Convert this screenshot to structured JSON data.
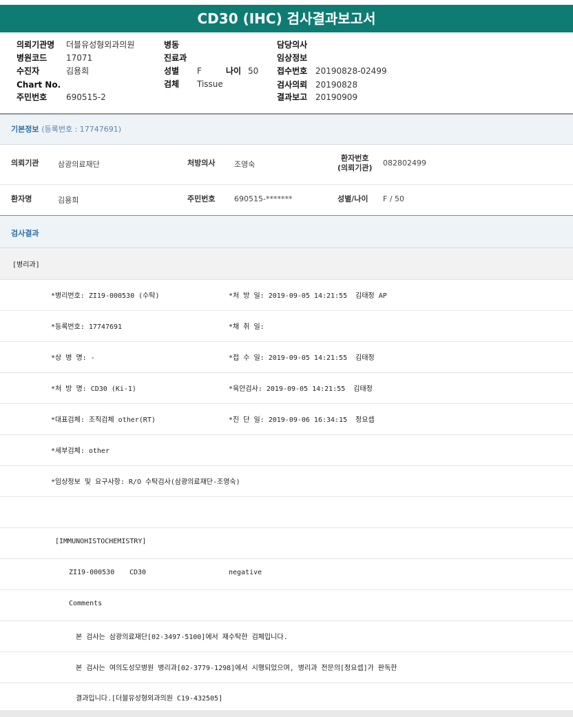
{
  "title": "CD30 (IHC) 검사결과보고서",
  "header": {
    "col1": [
      {
        "k": "의뢰기관명",
        "v": "더블유성형외과의원"
      },
      {
        "k": "병원코드",
        "v": "17071"
      },
      {
        "k": "수진자",
        "v": "김용희"
      },
      {
        "k": "Chart No.",
        "v": ""
      },
      {
        "k": "주민번호",
        "v": "690515-2"
      }
    ],
    "col2": [
      {
        "k": "병동",
        "v": ""
      },
      {
        "k": "진료과",
        "v": ""
      },
      {
        "k": "성별",
        "v": "F"
      },
      {
        "k": "검체",
        "v": "Tissue"
      }
    ],
    "age": {
      "k": "나이",
      "v": "50"
    },
    "col3": [
      {
        "k": "담당의사",
        "v": ""
      },
      {
        "k": "임상정보",
        "v": ""
      },
      {
        "k": "접수번호",
        "v": "20190828-02499"
      },
      {
        "k": "검사의뢰",
        "v": "20190828"
      },
      {
        "k": "결과보고",
        "v": "20190909"
      }
    ]
  },
  "basic": {
    "title": "기본정보",
    "subtitle": "(등록번호 : 17747691)",
    "row1": {
      "k1": "의뢰기관",
      "v1": "삼광의료재단",
      "k2": "처방의사",
      "v2": "조영숙",
      "k3a": "환자번호",
      "k3b": "(의뢰기관)",
      "v3": "082802499"
    },
    "row2": {
      "k1": "환자명",
      "v1": "김용희",
      "k2": "주민번호",
      "v2": "690515-*******",
      "k3": "성별/나이",
      "v3": "F / 50"
    }
  },
  "results": {
    "title": "검사결과",
    "dept": "[병리과]",
    "lines": [
      {
        "a": "*병리번호: ZI19-000530 (수탁)",
        "b": "*처 방 일: 2019-09-05 14:21:55  김태정 AP"
      },
      {
        "a": "*등록번호: 17747691",
        "b": "*채 취 일:"
      },
      {
        "a": "*상 병 명: -",
        "b": "*접 수 일: 2019-09-05 14:21:55  김태정"
      },
      {
        "a": "*처 방 명: CD30 (Ki-1)",
        "b": "*육안검사: 2019-09-05 14:21:55  김태정"
      },
      {
        "a": "*대표검체: 조직검체 other(RT)",
        "b": "*진 단 일: 2019-09-06 16:34:15  정요셉"
      },
      {
        "a": "*세부검체: other",
        "b": ""
      },
      {
        "a": "*임상정보 및 요구사항: R/O 수탁검사(삼광의료재단-조영숙)",
        "b": ""
      }
    ],
    "ihc_header": "[IMMUNOHISTOCHEMISTRY]",
    "ihc_row": {
      "id": "ZI19-000530",
      "marker": "CD30",
      "result": "negative"
    },
    "comments_label": "Comments",
    "comments": [
      "본 검사는 삼광의료재단[02-3497-5100]에서 재수탁한 검체입니다.",
      "본 검사는 여의도성모병원 병리과[02-3779-1298]에서 시행되었으며, 병리과 전문의[정요셉]가 판독한",
      "결과입니다.[더블유성형외과의원 C19-432505]"
    ]
  },
  "colors": {
    "title_bar": "#0e7c73",
    "section_title": "#2d6fa3"
  }
}
